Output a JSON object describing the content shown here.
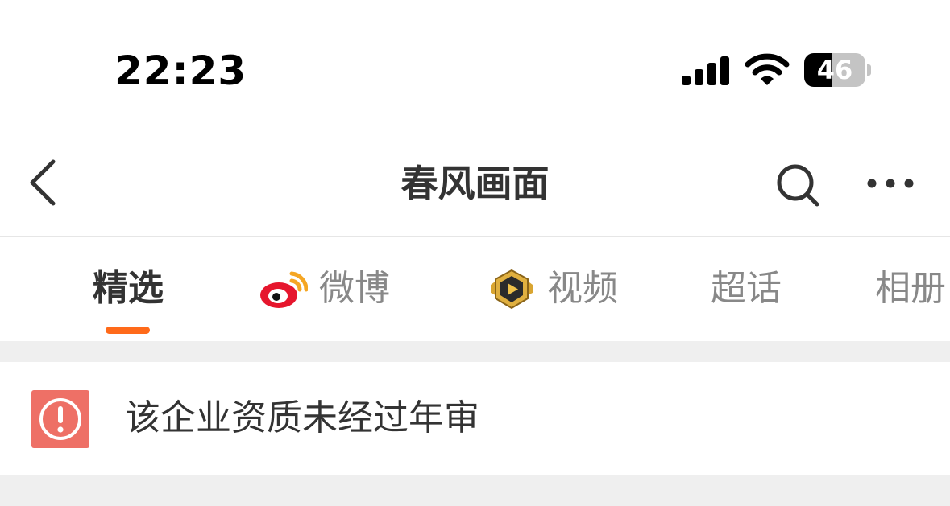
{
  "status_bar": {
    "time": "22:23",
    "battery_level": "46",
    "battery_fraction": 0.46,
    "signal_icon": "cellular-signal-icon",
    "wifi_icon": "wifi-icon"
  },
  "nav": {
    "title": "春风画面",
    "back_icon": "chevron-left-icon",
    "search_icon": "search-icon",
    "more_icon": "more-dots-icon"
  },
  "tabs": [
    {
      "label": "精选",
      "active": true
    },
    {
      "label": "微博",
      "icon": "weibo-logo-icon"
    },
    {
      "label": "视频",
      "icon": "video-badge-icon"
    },
    {
      "label": "超话"
    },
    {
      "label": "相册"
    }
  ],
  "notice": {
    "icon": "warning-icon",
    "text": "该企业资质未经过年审"
  },
  "colors": {
    "accent": "#ff6a1a",
    "warning": "#ee7066",
    "text_primary": "#333333",
    "text_secondary": "#888888",
    "gap_background": "#efefef"
  }
}
